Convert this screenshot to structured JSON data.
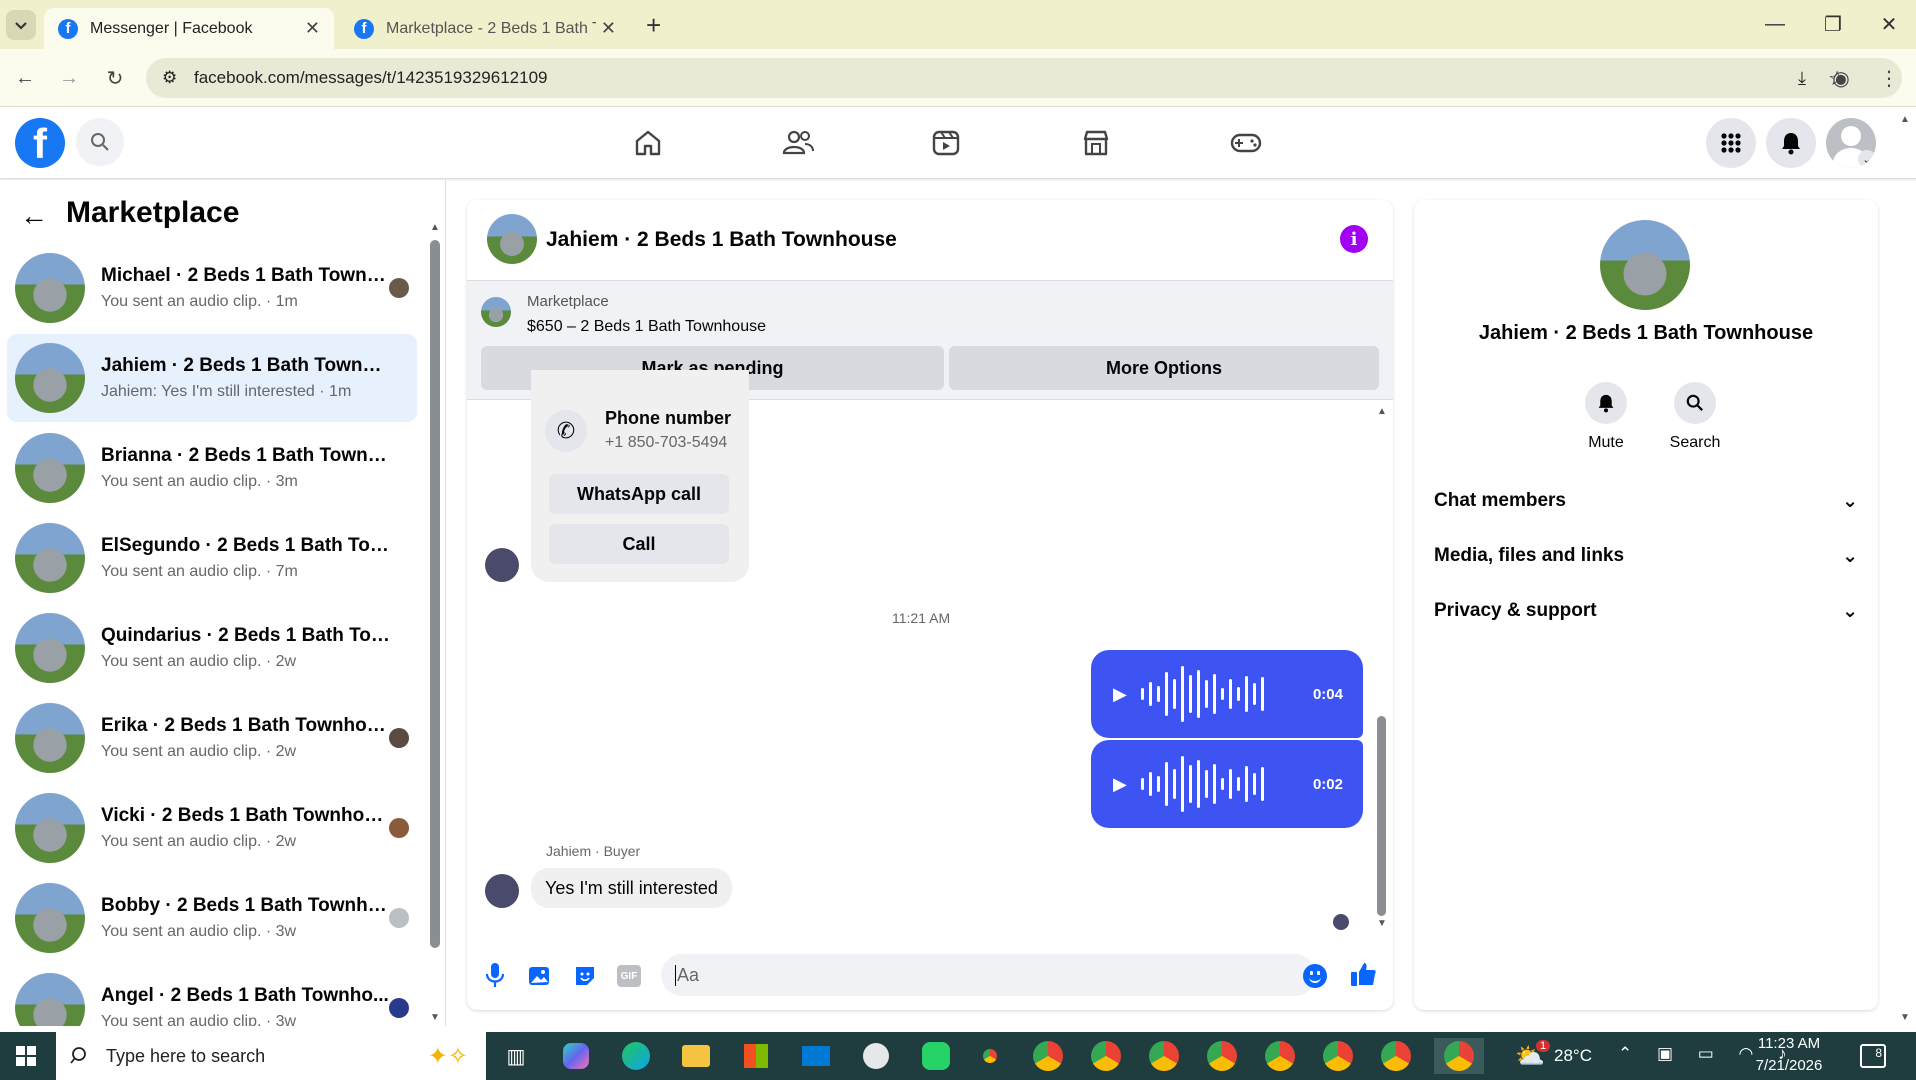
{
  "browser": {
    "tabs": [
      {
        "title": "Messenger | Facebook",
        "active": true
      },
      {
        "title": "Marketplace - 2 Beds 1 Bath To",
        "active": false
      }
    ],
    "url": "facebook.com/messages/t/1423519329612109"
  },
  "sidebar": {
    "title": "Marketplace",
    "conversations": [
      {
        "name": "Michael · 2 Beds 1 Bath Townh...",
        "preview": "You sent an audio clip. · 1m"
      },
      {
        "name": "Jahiem · 2 Beds 1 Bath Townhouse",
        "preview": "Jahiem: Yes I'm still interested · 1m"
      },
      {
        "name": "Brianna · 2 Beds 1 Bath Townhou...",
        "preview": "You sent an audio clip. · 3m"
      },
      {
        "name": "ElSegundo · 2 Beds 1 Bath Town...",
        "preview": "You sent an audio clip. · 7m"
      },
      {
        "name": "Quindarius · 2 Beds 1 Bath Town...",
        "preview": "You sent an audio clip. · 2w"
      },
      {
        "name": "Erika · 2 Beds 1 Bath Townhouse",
        "preview": "You sent an audio clip. · 2w"
      },
      {
        "name": "Vicki · 2 Beds 1 Bath Townhouse",
        "preview": "You sent an audio clip. · 2w"
      },
      {
        "name": "Bobby · 2 Beds 1 Bath Townho...",
        "preview": "You sent an audio clip. · 3w"
      },
      {
        "name": "Angel · 2 Beds 1 Bath Townho...",
        "preview": "You sent an audio clip. · 3w"
      }
    ]
  },
  "chat": {
    "title": "Jahiem · 2 Beds 1 Bath Townhouse",
    "listing_source": "Marketplace",
    "listing": "$650 – 2 Beds 1 Bath Townhouse",
    "mark_pending": "Mark as pending",
    "more_options": "More Options",
    "phone_label": "Phone number",
    "phone": "+1 850-703-5494",
    "whatsapp": "WhatsApp call",
    "call": "Call",
    "timestamp": "11:21 AM",
    "audio1": "0:04",
    "audio2": "0:02",
    "sender_label": "Jahiem · Buyer",
    "last_message": "Yes I'm still interested",
    "input_placeholder": "Aa"
  },
  "details": {
    "name": "Jahiem · 2 Beds 1 Bath Townhouse",
    "mute": "Mute",
    "search": "Search",
    "sections": [
      "Chat members",
      "Media, files and links",
      "Privacy & support"
    ]
  },
  "taskbar": {
    "search": "Type here to search",
    "temp": "28°C",
    "time": "11:23 AM",
    "date": "7/21/2026",
    "weather_badge": "1",
    "notif_count": "8"
  }
}
